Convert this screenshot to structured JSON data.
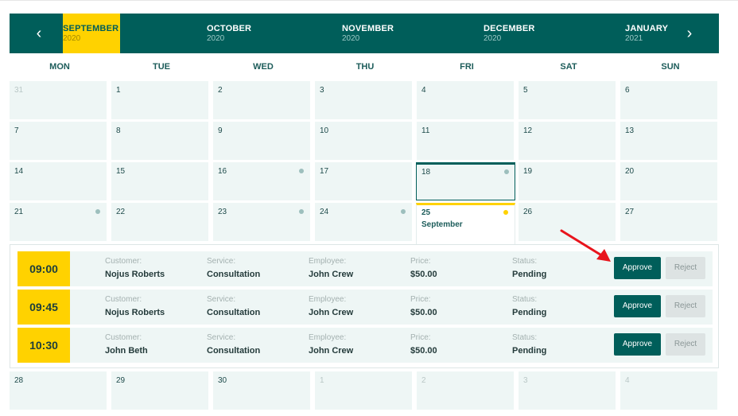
{
  "months": {
    "prev_icon": "chevron-left-icon",
    "next_icon": "chevron-right-icon",
    "items": [
      {
        "name": "SEPTEMBER",
        "year": "2020"
      },
      {
        "name": "OCTOBER",
        "year": "2020"
      },
      {
        "name": "NOVEMBER",
        "year": "2020"
      },
      {
        "name": "DECEMBER",
        "year": "2020"
      },
      {
        "name": "JANUARY",
        "year": "2021"
      }
    ]
  },
  "weekdays": [
    "MON",
    "TUE",
    "WED",
    "THU",
    "FRI",
    "SAT",
    "SUN"
  ],
  "weeks": [
    [
      "31",
      "1",
      "2",
      "3",
      "4",
      "5",
      "6"
    ],
    [
      "7",
      "8",
      "9",
      "10",
      "11",
      "12",
      "13"
    ],
    [
      "14",
      "15",
      "16",
      "17",
      "18",
      "19",
      "20"
    ],
    [
      "21",
      "22",
      "23",
      "24",
      "25",
      "26",
      "27"
    ],
    [
      "28",
      "29",
      "30",
      "1",
      "2",
      "3",
      "4"
    ]
  ],
  "expanded_day": {
    "day": "25",
    "month": "September"
  },
  "appointments": [
    {
      "time": "09:00",
      "customer_label": "Customer:",
      "customer": "Nojus Roberts",
      "service_label": "Service:",
      "service": "Consultation",
      "employee_label": "Employee:",
      "employee": "John Crew",
      "price_label": "Price:",
      "price": "$50.00",
      "status_label": "Status:",
      "status": "Pending",
      "approve": "Approve",
      "reject": "Reject"
    },
    {
      "time": "09:45",
      "customer_label": "Customer:",
      "customer": "Nojus Roberts",
      "service_label": "Service:",
      "service": "Consultation",
      "employee_label": "Employee:",
      "employee": "John Crew",
      "price_label": "Price:",
      "price": "$50.00",
      "status_label": "Status:",
      "status": "Pending",
      "approve": "Approve",
      "reject": "Reject"
    },
    {
      "time": "10:30",
      "customer_label": "Customer:",
      "customer": "John Beth",
      "service_label": "Service:",
      "service": "Consultation",
      "employee_label": "Employee:",
      "employee": "John Crew",
      "price_label": "Price:",
      "price": "$50.00",
      "status_label": "Status:",
      "status": "Pending",
      "approve": "Approve",
      "reject": "Reject"
    }
  ],
  "colors": {
    "primary": "#005e5a",
    "accent": "#ffd200",
    "cell": "#eef6f5",
    "annotation_arrow": "#e8141c"
  }
}
